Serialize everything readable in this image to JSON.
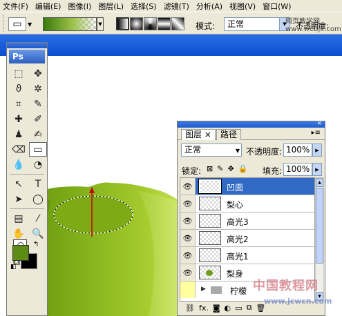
{
  "menubar": {
    "items": [
      "文件(F)",
      "编辑(E)",
      "图像(I)",
      "图层(L)",
      "选择(S)",
      "滤镜(T)",
      "分析(A)",
      "视图(V)",
      "窗口(W)"
    ]
  },
  "options_bar": {
    "mode_label": "模式:",
    "mode_value": "正常",
    "opacity_label": "不透明度:"
  },
  "toolbox": {
    "logo": "Ps"
  },
  "layers_panel": {
    "tab_layers": "图层",
    "tab_paths": "路径",
    "blend_mode": "正常",
    "opacity_label": "不透明度:",
    "opacity_value": "100%",
    "lock_label": "锁定:",
    "fill_label": "填充:",
    "fill_value": "100%",
    "layers": [
      {
        "name": "凹面",
        "selected": true
      },
      {
        "name": "梨心",
        "selected": false
      },
      {
        "name": "高光3",
        "selected": false
      },
      {
        "name": "高光2",
        "selected": false
      },
      {
        "name": "高光1",
        "selected": false
      },
      {
        "name": "梨身",
        "selected": false
      }
    ],
    "group": {
      "name": "柠檬"
    }
  },
  "watermark": {
    "top_line1": "网页教学网",
    "top_line2": "www.webjx.com",
    "bottom_text": "中国教程网",
    "bottom_url": "www.jcwcn.com"
  },
  "colors": {
    "foreground": "#5c8c14",
    "background": "#000000",
    "selection_blue": "#316ac5"
  }
}
